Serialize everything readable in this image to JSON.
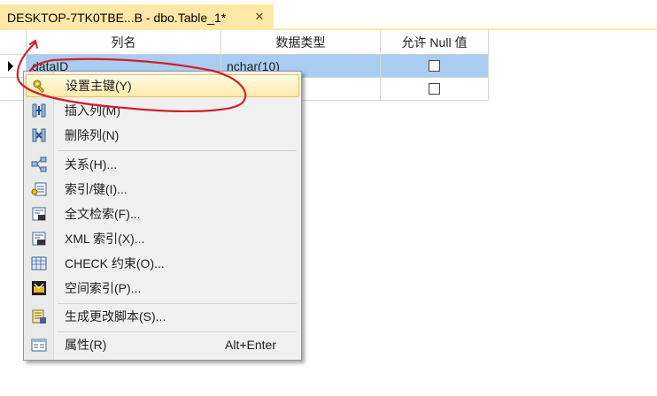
{
  "tab": {
    "title": "DESKTOP-7TK0TBE...B - dbo.Table_1*",
    "close_glyph": "✕"
  },
  "grid": {
    "headers": [
      "列名",
      "数据类型",
      "允许 Null 值"
    ],
    "rows": [
      {
        "name": "dataID",
        "type": "nchar(10)",
        "nullable": false,
        "selected": true
      },
      {
        "name": "",
        "type": "",
        "nullable": false,
        "selected": false
      }
    ]
  },
  "context_menu": {
    "items": [
      {
        "label": "设置主键(Y)",
        "icon": "key-icon",
        "shortcut": "",
        "highlighted": true
      },
      {
        "label": "插入列(M)",
        "icon": "insert-column-icon",
        "shortcut": ""
      },
      {
        "label": "删除列(N)",
        "icon": "delete-column-icon",
        "shortcut": ""
      },
      {
        "label": "关系(H)...",
        "icon": "relationship-icon",
        "shortcut": ""
      },
      {
        "label": "索引/键(I)...",
        "icon": "index-icon",
        "shortcut": ""
      },
      {
        "label": "全文检索(F)...",
        "icon": "fulltext-icon",
        "shortcut": ""
      },
      {
        "label": "XML 索引(X)...",
        "icon": "xml-index-icon",
        "shortcut": ""
      },
      {
        "label": "CHECK 约束(O)...",
        "icon": "check-constraint-icon",
        "shortcut": ""
      },
      {
        "label": "空间索引(P)...",
        "icon": "spatial-index-icon",
        "shortcut": ""
      },
      {
        "label": "生成更改脚本(S)...",
        "icon": "script-icon",
        "shortcut": ""
      },
      {
        "label": "属性(R)",
        "icon": "properties-icon",
        "shortcut": "Alt+Enter"
      }
    ]
  },
  "colors": {
    "tab_bg": "#ffe8a6",
    "selected_row": "#a8cdf0",
    "annotation": "#d0202a"
  }
}
